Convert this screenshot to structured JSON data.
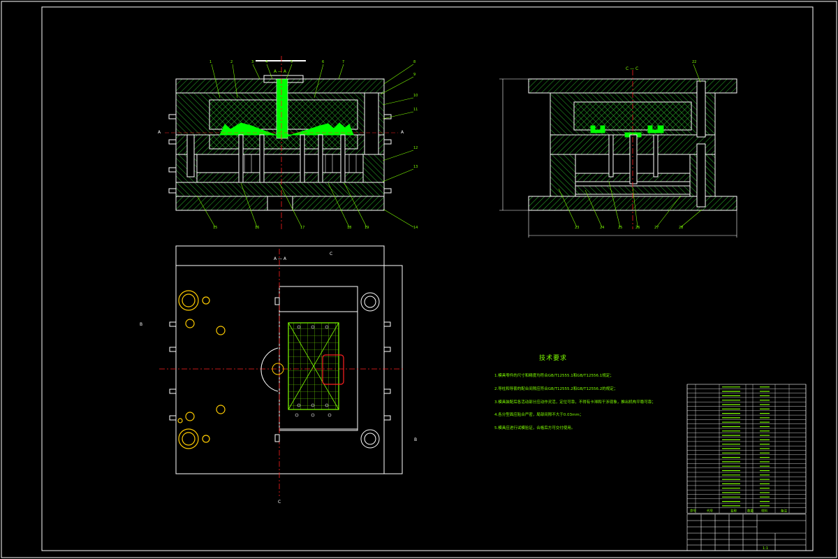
{
  "title": "",
  "section_labels": {
    "section_aa": "A — A",
    "section_cc": "C — C",
    "section_bb": "B — B",
    "plan_aa": "A — A",
    "letter_a_left": "A",
    "letter_a_right": "A",
    "letter_b_left": "B",
    "letter_b_right": "B",
    "letter_c_top": "C",
    "letter_c_bottom": "C"
  },
  "leader_numbers_left_top": [
    "1",
    "2",
    "3",
    "4",
    "5",
    "6",
    "7"
  ],
  "leader_numbers_left_right": [
    "8",
    "9",
    "10",
    "11",
    "12",
    "13",
    "14"
  ],
  "leader_numbers_left_bottom": [
    "15",
    "16",
    "17",
    "18",
    "19",
    "20",
    "21"
  ],
  "leader_numbers_right_top": [
    "22"
  ],
  "leader_numbers_right_bottom": [
    "23",
    "24",
    "25",
    "26",
    "27",
    "28"
  ],
  "technical_requirements": {
    "title": "技术要求",
    "items": [
      "1.模具零件的尺寸和精度均符合GB/T12555.1和GB/T12556.1规定；",
      "2.导柱和导套的配合间隙应符合GB/T12555.2和GB/T12556.2的规定；",
      "3.模具装配后各活动部分应动作灵活，定位可靠，不得有卡滞和干涉现象，推出机构平稳可靠；",
      "4.各分型面应贴合严密，局部间隙不大于0.03mm；",
      "5.模具应进行试模验证，合格后方可交付使用。"
    ]
  },
  "bom": {
    "rows": 28,
    "header": [
      "序号",
      "代号",
      "名称",
      "数量",
      "材料",
      "备注"
    ]
  },
  "title_block": {
    "drawing_name": "",
    "scale": "1:1"
  },
  "colors": {
    "background": "#000000",
    "line": "#ffffff",
    "hatch": "#7fff00",
    "part": "#00ff00",
    "centerline": "#ff2020",
    "holes": "#ffcc00",
    "text": "#7fff00"
  }
}
